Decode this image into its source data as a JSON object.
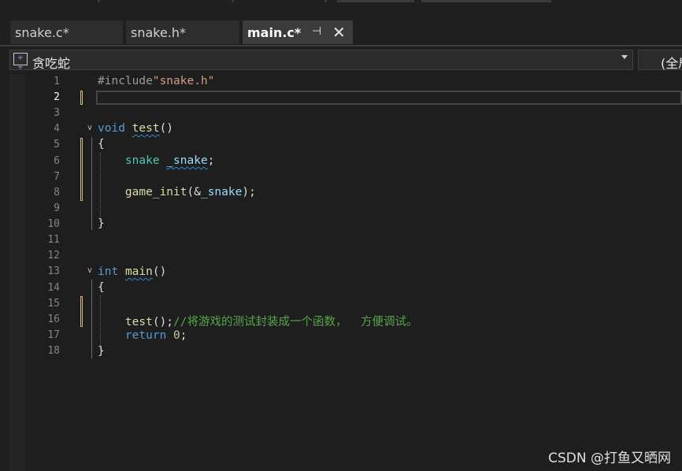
{
  "tabs": [
    {
      "label": "snake.c*"
    },
    {
      "label": "snake.h*"
    },
    {
      "label": "main.c*",
      "pin_icon": "pin-icon",
      "close_icon": "close-icon"
    }
  ],
  "nav": {
    "project": "贪吃蛇",
    "project_icon": "project-icon",
    "scope": "(全局"
  },
  "editor": {
    "line_numbers": [
      "1",
      "2",
      "3",
      "4",
      "5",
      "6",
      "7",
      "8",
      "9",
      "10",
      "11",
      "12",
      "13",
      "14",
      "15",
      "16",
      "17",
      "18"
    ],
    "current_line": "2",
    "lines": {
      "l1_pre": "#include",
      "l1_str": "\"snake.h\"",
      "l4_kw": "void",
      "l4_fn": "test",
      "l4_rest": "()",
      "l5": "{",
      "l6_type": "snake",
      "l6_var": "_snake",
      "l6_end": ";",
      "l8_fn": "game_init",
      "l8_open": "(&",
      "l8_var": "_snake",
      "l8_close": ");",
      "l10": "}",
      "l13_kw": "int",
      "l13_fn": "main",
      "l13_rest": "()",
      "l14": "{",
      "l16_fn": "test",
      "l16_rest": "();",
      "l16_comment": "//将游戏的测试封装成一个函数，  方便调试。",
      "l17_kw": "return",
      "l17_num": "0",
      "l17_end": ";",
      "l18": "}"
    }
  },
  "watermark": "CSDN @打鱼又晒网",
  "colors": {
    "keyword": "#569cd6",
    "function": "#dcdcaa",
    "type": "#4ec9b0",
    "variable": "#9cdcfe",
    "string": "#d69d85",
    "comment": "#57a64a",
    "change_marker": "#d7ba7d"
  }
}
